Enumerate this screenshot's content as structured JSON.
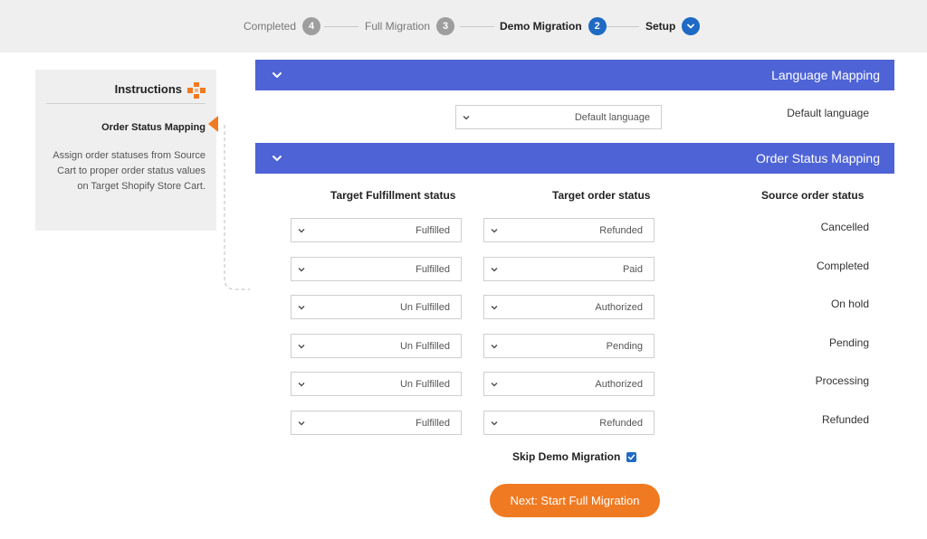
{
  "stepper": {
    "steps": [
      {
        "num": "",
        "label": "Setup"
      },
      {
        "num": "2",
        "label": "Demo Migration"
      },
      {
        "num": "3",
        "label": "Full Migration"
      },
      {
        "num": "4",
        "label": "Completed"
      }
    ],
    "active_color": "#1e6ac4",
    "inactive_color": "#9e9e9e"
  },
  "instructions": {
    "title": "Instructions",
    "subtitle": "Order Status Mapping",
    "text": "Assign order statuses from Source Cart to proper order status values on Target Shopify Store Cart."
  },
  "language_mapping": {
    "title": "Language Mapping",
    "default_label": "Default language",
    "default_value": "Default language"
  },
  "order_status_mapping": {
    "title": "Order Status Mapping",
    "headers": {
      "source": "Source order status",
      "target": "Target order status",
      "fulfillment": "Target Fulfillment status"
    },
    "rows": [
      {
        "source": "Cancelled",
        "target": "Refunded",
        "fulfillment": "Fulfilled"
      },
      {
        "source": "Completed",
        "target": "Paid",
        "fulfillment": "Fulfilled"
      },
      {
        "source": "On hold",
        "target": "Authorized",
        "fulfillment": "Un Fulfilled"
      },
      {
        "source": "Pending",
        "target": "Pending",
        "fulfillment": "Un Fulfilled"
      },
      {
        "source": "Processing",
        "target": "Authorized",
        "fulfillment": "Un Fulfilled"
      },
      {
        "source": "Refunded",
        "target": "Refunded",
        "fulfillment": "Fulfilled"
      }
    ]
  },
  "skip_demo": {
    "label": "Skip Demo Migration",
    "checked": true
  },
  "next_button": {
    "label": "Next: Start Full Migration"
  },
  "colors": {
    "header_blue": "#4e63d6",
    "accent_orange": "#f07a22"
  }
}
